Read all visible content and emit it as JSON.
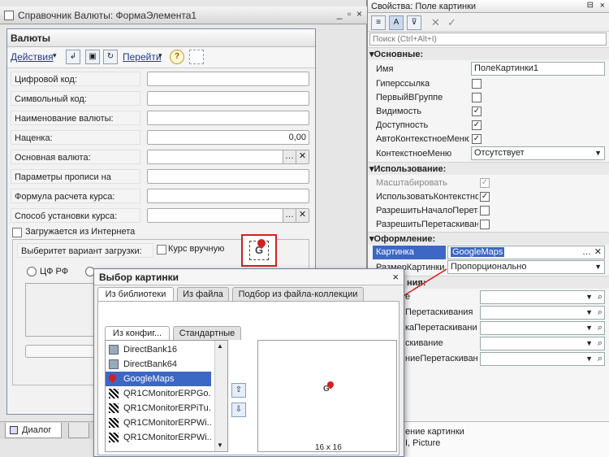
{
  "designer": {
    "title": "Справочник Валюты: ФормаЭлемента1",
    "form_title": "Валюты",
    "toolbar": {
      "actions": "Действия",
      "navigate": "Перейти",
      "help": "?"
    },
    "fields": [
      {
        "label": "Цифровой код:"
      },
      {
        "label": "Символьный код:"
      },
      {
        "label": "Наименование валюты:"
      },
      {
        "label": "Наценка:",
        "value": "0,00"
      },
      {
        "label": "Основная валюта:"
      },
      {
        "label": "Параметры прописи на русском:"
      },
      {
        "label": "Формула расчета курса:"
      },
      {
        "label": "Способ установки курса:"
      }
    ],
    "internet_check": "Загружается из Интернета",
    "variant_label": "Выберитет вариант загрузки:",
    "manual_check": "Курс вручную",
    "radio_label": "ЦФ РФ",
    "dialog_tab": "Диалог",
    "close_glyph": "×"
  },
  "props": {
    "title": "Свойства: Поле картинки",
    "search_placeholder": "Поиск (Ctrl+Alt+I)",
    "sections": {
      "main": "Основные:",
      "usage": "Использование:",
      "design": "Оформление:",
      "misc": "ния:"
    },
    "rows": {
      "name": {
        "label": "Имя",
        "value": "ПолеКартинки1"
      },
      "hyperlink": "Гиперссылка",
      "first_in_group": "ПервыйВГруппе",
      "visible": "Видимость",
      "enabled": "Доступность",
      "autocontext": "АвтоКонтекстноеМеню",
      "context": {
        "label": "КонтекстноеМеню",
        "value": "Отсутствует"
      },
      "scale": "Масштабировать",
      "usecontext": "ИспользоватьКонтекстно",
      "allow_drag_start": "РазрешитьНачалоПерета",
      "allow_drag": "РазрешитьПеретаскивани",
      "picture": {
        "label": "Картинка",
        "value": "GoogleMaps"
      },
      "picture_size": {
        "label": "РазмерКартинки",
        "value": "Пропорционально"
      },
      "hidden1": "e",
      "hidden2": "Перетаскивания",
      "hidden3": "каПеретаскивани",
      "hidden4": "скивание",
      "hidden5": "ниеПеретаскивани"
    },
    "footer": {
      "line1": "ение картинки",
      "line2": "I, Picture"
    }
  },
  "dialog": {
    "title": "Выбор картинки",
    "tabs": [
      "Из библиотеки",
      "Из файла",
      "Подбор из файла-коллекции"
    ],
    "subtabs": [
      "Из конфиг...",
      "Стандартные"
    ],
    "items": [
      "DirectBank16",
      "DirectBank64",
      "GoogleMaps",
      "QR1CMonitorERPGo...",
      "QR1CMonitorERPiTu...",
      "QR1CMonitorERPWi...",
      "QR1CMonitorERPWi..."
    ],
    "selected_index": 2,
    "preview_size": "16 x 16",
    "preview_glyph": "G"
  },
  "colors": {
    "selection": "#3d67c4",
    "accent_red": "#d32020",
    "link": "#1a3c8f"
  }
}
